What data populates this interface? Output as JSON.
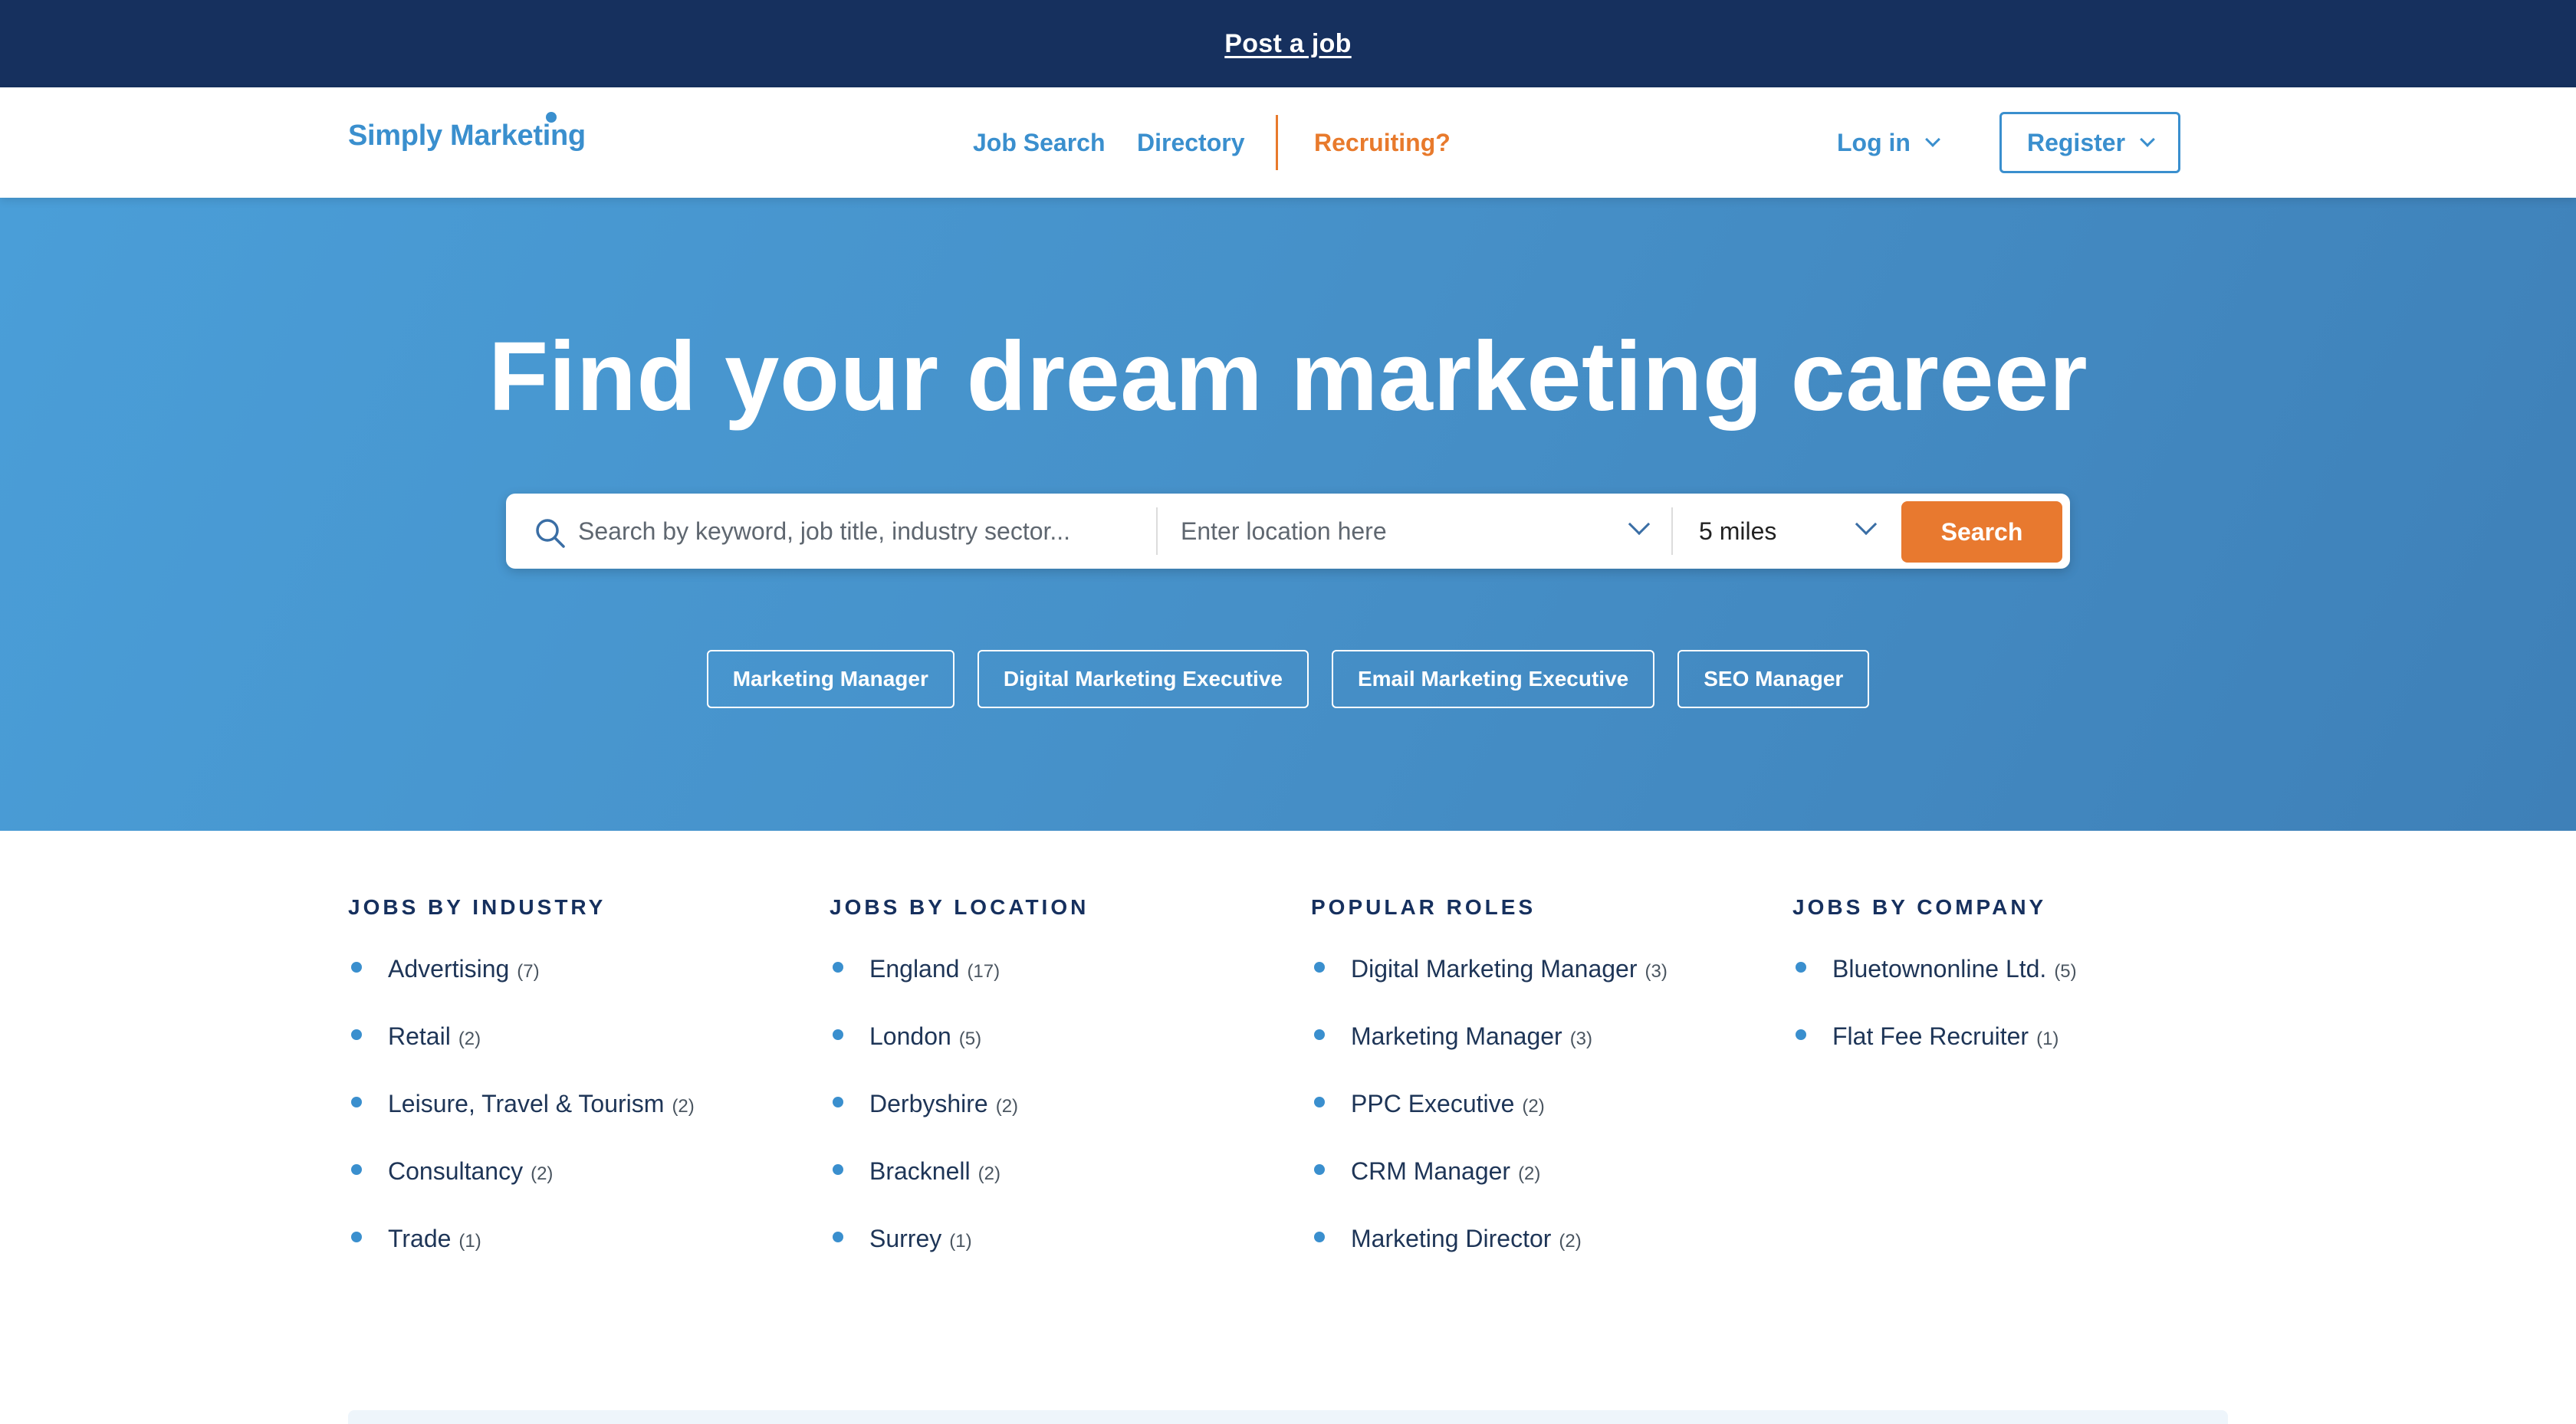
{
  "topbar": {
    "post_job": "Post a job"
  },
  "nav": {
    "logo": "Simply Marketing",
    "job_search": "Job Search",
    "directory": "Directory",
    "recruiting": "Recruiting?",
    "login": "Log in",
    "register": "Register"
  },
  "hero": {
    "title": "Find your dream marketing career",
    "search": {
      "keyword_placeholder": "Search by keyword, job title, industry sector...",
      "location_placeholder": "Enter location here",
      "radius": "5 miles",
      "button": "Search"
    },
    "chips": [
      "Marketing Manager",
      "Digital Marketing Executive",
      "Email Marketing Executive",
      "SEO Manager"
    ]
  },
  "columns": [
    {
      "title": "JOBS BY INDUSTRY",
      "items": [
        {
          "label": "Advertising",
          "count": "(7)"
        },
        {
          "label": "Retail",
          "count": "(2)"
        },
        {
          "label": "Leisure, Travel & Tourism",
          "count": "(2)"
        },
        {
          "label": "Consultancy",
          "count": "(2)"
        },
        {
          "label": "Trade",
          "count": "(1)"
        }
      ]
    },
    {
      "title": "JOBS BY LOCATION",
      "items": [
        {
          "label": "England",
          "count": "(17)"
        },
        {
          "label": "London",
          "count": "(5)"
        },
        {
          "label": "Derbyshire",
          "count": "(2)"
        },
        {
          "label": "Bracknell",
          "count": "(2)"
        },
        {
          "label": "Surrey",
          "count": "(1)"
        }
      ]
    },
    {
      "title": "POPULAR ROLES",
      "items": [
        {
          "label": "Digital Marketing Manager",
          "count": "(3)"
        },
        {
          "label": "Marketing Manager",
          "count": "(3)"
        },
        {
          "label": "PPC Executive",
          "count": "(2)"
        },
        {
          "label": "CRM Manager",
          "count": "(2)"
        },
        {
          "label": "Marketing Director",
          "count": "(2)"
        }
      ]
    },
    {
      "title": "JOBS BY COMPANY",
      "items": [
        {
          "label": "Bluetownonline Ltd.",
          "count": "(5)"
        },
        {
          "label": "Flat Fee Recruiter",
          "count": "(1)"
        }
      ]
    }
  ],
  "colors": {
    "navy": "#16305e",
    "blue": "#3a8fce",
    "orange": "#e8792f"
  },
  "icons": {
    "search": "search-icon",
    "chevron": "chevron-down-icon"
  }
}
